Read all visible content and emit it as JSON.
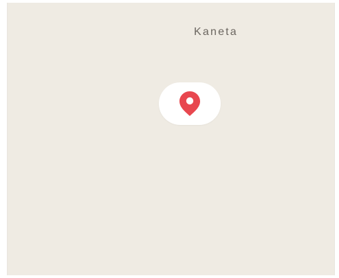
{
  "map": {
    "place_label": "Kaneta",
    "marker_icon": "map-pin-icon",
    "colors": {
      "land": "#efebe3",
      "label_text": "#6b6660",
      "marker_fill": "#e8474f",
      "marker_background": "#ffffff"
    }
  }
}
